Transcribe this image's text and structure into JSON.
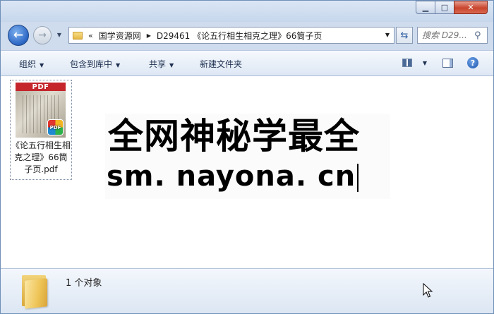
{
  "window": {
    "controls": {
      "minimize": "▁",
      "maximize": "□",
      "close": "✕"
    }
  },
  "nav": {
    "back_icon": "left-arrow",
    "forward_icon": "right-arrow",
    "breadcrumb_chevron": "«",
    "breadcrumb": [
      "国学资源网",
      "D29461 《论五行相生相克之理》66筒子页"
    ],
    "search_placeholder": "搜索 D29..."
  },
  "toolbar": {
    "organize": "组织",
    "include_in_library": "包含到库中",
    "share": "共享",
    "new_folder": "新建文件夹",
    "help": "?"
  },
  "files": [
    {
      "thumb_header": "PDF",
      "badge": "PDF",
      "name": "《论五行相生相克之理》66筒子页.pdf"
    }
  ],
  "watermark": {
    "line1": "全网神秘学最全",
    "line2": "sm. nayona. cn"
  },
  "status": {
    "count": "1 个对象"
  },
  "colors": {
    "close_button": "#c8442c",
    "pdf_red": "#c4262c",
    "chrome": "#cfdcee"
  }
}
